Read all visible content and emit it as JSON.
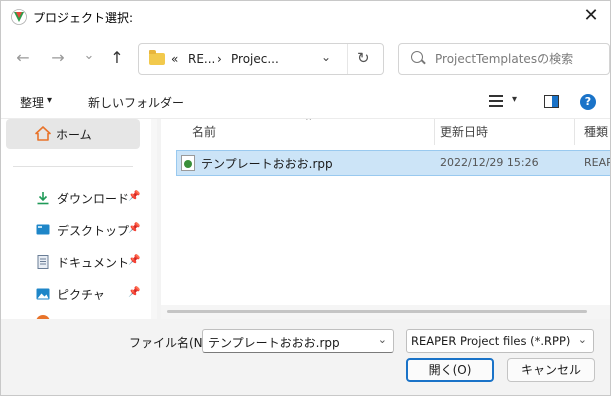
{
  "window": {
    "title": "プロジェクト選択:",
    "close_glyph": "✕"
  },
  "nav": {
    "back_glyph": "←",
    "forward_glyph": "→",
    "recent_glyph": "⌄",
    "up_glyph": "↑"
  },
  "address": {
    "overflow": "«",
    "crumbs": [
      "RE...",
      "Projec..."
    ],
    "separator": "›",
    "dropdown_glyph": "⌄",
    "refresh_glyph": "↻"
  },
  "search": {
    "placeholder": "ProjectTemplatesの検索"
  },
  "toolbar": {
    "organize_label": "整理",
    "organize_caret": "▾",
    "new_folder_label": "新しいフォルダー",
    "view_caret": "▾",
    "help_glyph": "?"
  },
  "sidebar": {
    "home_label": "ホーム",
    "pin_glyph": "📌",
    "items": [
      {
        "label": "ダウンロード",
        "icon": "download-icon"
      },
      {
        "label": "デスクトップ",
        "icon": "desktop-icon"
      },
      {
        "label": "ドキュメント",
        "icon": "document-icon"
      },
      {
        "label": "ピクチャ",
        "icon": "pictures-icon"
      }
    ]
  },
  "filelist": {
    "columns": [
      "名前",
      "更新日時",
      "種類"
    ],
    "sort_caret": "⌃",
    "rows": [
      {
        "name": "テンプレートおおお.rpp",
        "modified": "2022/12/29 15:26",
        "type": "REAPE"
      }
    ]
  },
  "footer": {
    "filename_label": "ファイル名(N):",
    "filename_value": "テンプレートおおお.rpp",
    "filetype_value": "REAPER Project files (*.RPP)",
    "dropdown_glyph": "⌄",
    "open_label": "開く(O)",
    "cancel_label": "キャンセル"
  },
  "colors": {
    "accent": "#1a73c8",
    "selection": "#cce4f7",
    "selection_border": "#99c9ef",
    "home_orange": "#e8732a",
    "download_green": "#1f9a58",
    "desktop_teal": "#1e86c8"
  }
}
